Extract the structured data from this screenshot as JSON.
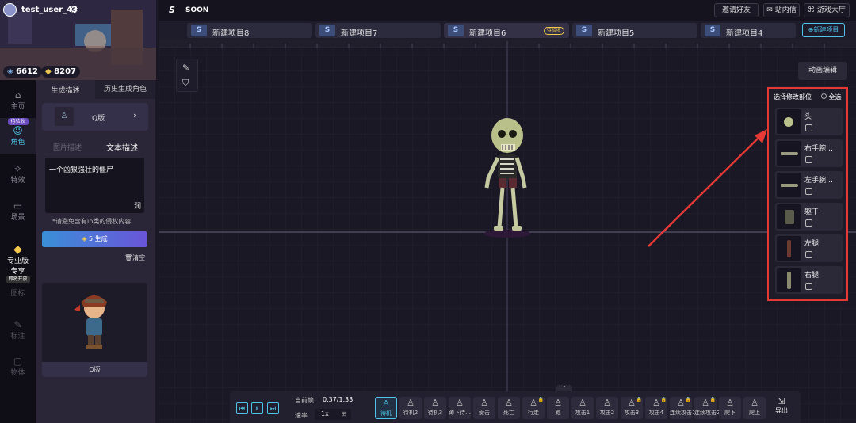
{
  "user": {
    "name": "test_user_43",
    "coins_a": "6612",
    "coins_b": "8207"
  },
  "nav": {
    "items": [
      {
        "label": "主页"
      },
      {
        "label": "角色",
        "badge": "待验收"
      },
      {
        "label": "特效"
      },
      {
        "label": "场景"
      },
      {
        "label": "专业版",
        "label2": "专享",
        "badge": "即将开放"
      },
      {
        "label": "图标"
      },
      {
        "label": "标注"
      },
      {
        "label": "物体"
      }
    ]
  },
  "panel": {
    "tabs": [
      "生成描述",
      "历史生成角色"
    ],
    "style_label": "Q版",
    "desc_tabs": [
      "图片描述",
      "文本描述"
    ],
    "prompt_text": "一个凶狠强壮的僵尸",
    "polish_label": "润",
    "hint": "*请避免含有ip类的侵权内容",
    "generate_cost": "5",
    "generate_label": "生成",
    "clear_label": "清空",
    "preview_caption": "Q版"
  },
  "header": {
    "brand": "SOON",
    "invite": "邀请好友",
    "inbox": "站内信",
    "lobby": "游戏大厅"
  },
  "project_tabs": [
    {
      "label": "新建项目8"
    },
    {
      "label": "新建项目7"
    },
    {
      "label": "新建项目6",
      "badge": "待验收"
    },
    {
      "label": "新建项目5"
    },
    {
      "label": "新建项目4"
    }
  ],
  "new_project": "新建项目",
  "anim_edit": "动画编辑",
  "parts_panel": {
    "title": "选择修改部位",
    "select_all": "全选",
    "items": [
      {
        "label": "头"
      },
      {
        "label": "右手腕…"
      },
      {
        "label": "左手腕…"
      },
      {
        "label": "躯干"
      },
      {
        "label": "左腿"
      },
      {
        "label": "右腿"
      }
    ]
  },
  "player": {
    "frame_label": "当前帧:",
    "frame_value": "0.37/1.33",
    "speed_label": "速率",
    "speed_value": "1x"
  },
  "actions": [
    {
      "label": "待机",
      "selected": true
    },
    {
      "label": "待机2"
    },
    {
      "label": "待机3"
    },
    {
      "label": "蹲下待…"
    },
    {
      "label": "受击"
    },
    {
      "label": "死亡"
    },
    {
      "label": "行走",
      "locked": true
    },
    {
      "label": "跑"
    },
    {
      "label": "攻击1"
    },
    {
      "label": "攻击2"
    },
    {
      "label": "攻击3",
      "locked": true
    },
    {
      "label": "攻击4",
      "locked": true
    },
    {
      "label": "连续攻击1",
      "locked": true
    },
    {
      "label": "连续攻击2",
      "locked": true
    },
    {
      "label": "爬下"
    },
    {
      "label": "爬上"
    }
  ],
  "export_label": "导出",
  "colors": {
    "accent": "#4fc3e8",
    "highlight_box": "#e53935",
    "arrow": "#e53935"
  }
}
